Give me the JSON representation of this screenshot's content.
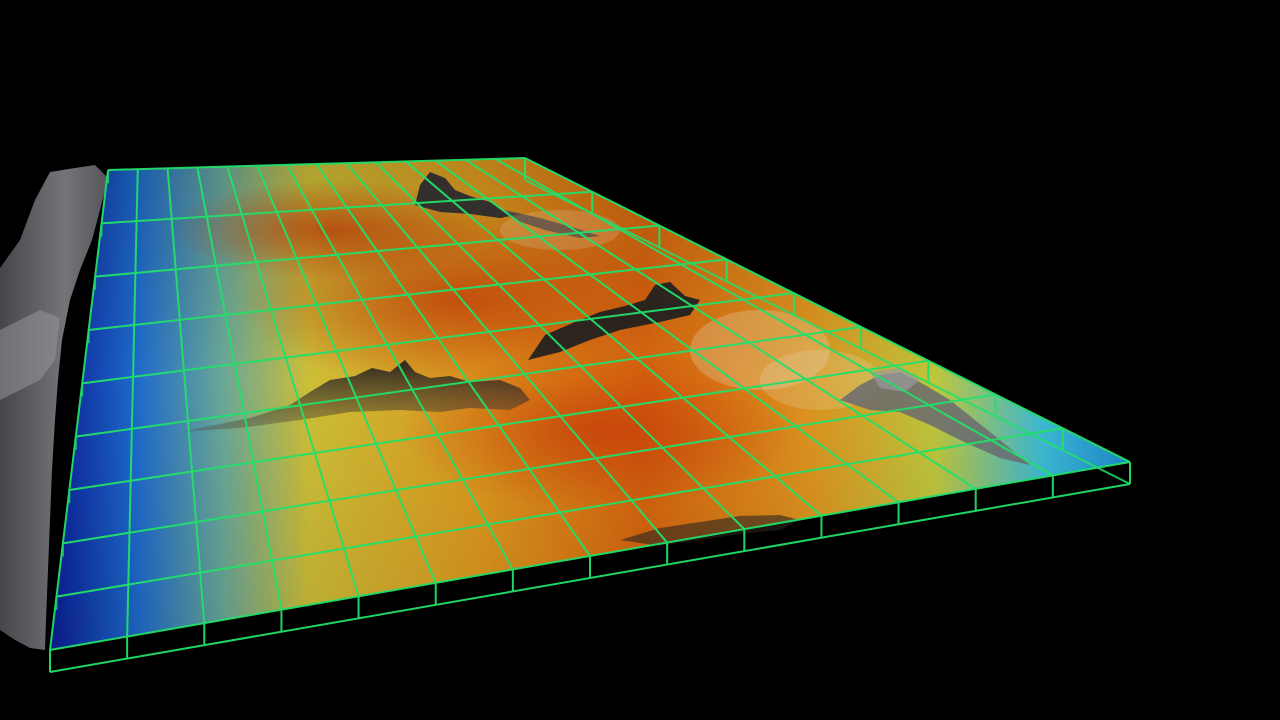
{
  "scene": {
    "description_kind": "3d-volume-render",
    "background_color": "#000000",
    "grid_color": "#22e06a",
    "grid_rows": 9,
    "grid_cols": 14,
    "colormap": [
      "#0a1e9c",
      "#1f6fd6",
      "#3fc3e0",
      "#d8c83a",
      "#e8a020",
      "#e06a10",
      "#c84a0a"
    ],
    "terrain_color": "#5a5a5e"
  }
}
